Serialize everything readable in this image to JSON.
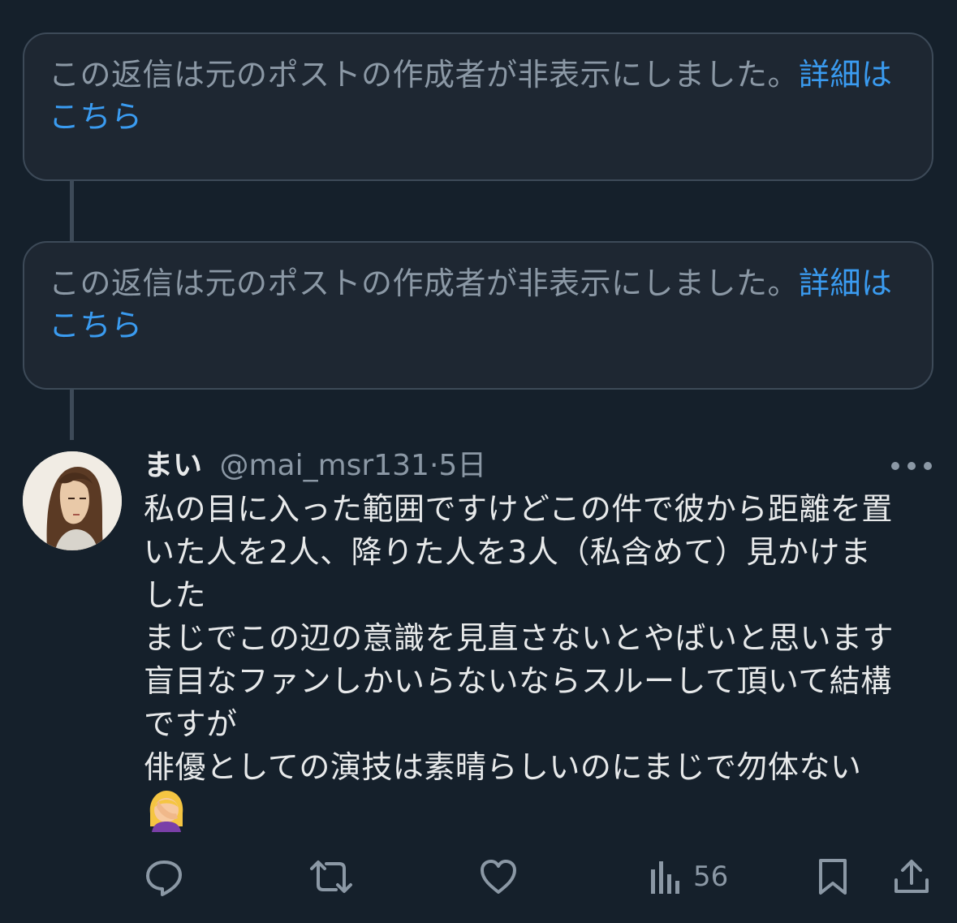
{
  "hidden_replies": [
    {
      "message": "この返信は元のポストの作成者が非表示にしました。",
      "link": "詳細はこちら"
    },
    {
      "message": "この返信は元のポストの作成者が非表示にしました。",
      "link": "詳細はこちら"
    }
  ],
  "post": {
    "display_name": "まい",
    "handle": "@mai_msr131",
    "separator": "·",
    "time": "5日",
    "body_lines": [
      "私の目に入った範囲ですけどこの件で彼から距離を置",
      "いた人を2人、降りた人を3人（私含めて）見かけま",
      "した",
      "まじでこの辺の意識を見直さないとやばいと思います",
      "盲目なファンしかいらないならスルーして頂いて結構",
      "ですが",
      "俳優としての演技は素晴らしいのにまじで勿体ない"
    ],
    "emoji": "face-palm-woman-emoji"
  },
  "actions": {
    "reply_icon": "reply-icon",
    "repost_icon": "repost-icon",
    "like_icon": "like-icon",
    "views_icon": "views-icon",
    "views_count": "56",
    "bookmark_icon": "bookmark-icon",
    "share_icon": "share-icon"
  },
  "colors": {
    "background": "#15202b",
    "card_background": "#1e2732",
    "link": "#3a9bf0",
    "muted_text": "#8b98a5",
    "primary_text": "#e7e9ea"
  }
}
